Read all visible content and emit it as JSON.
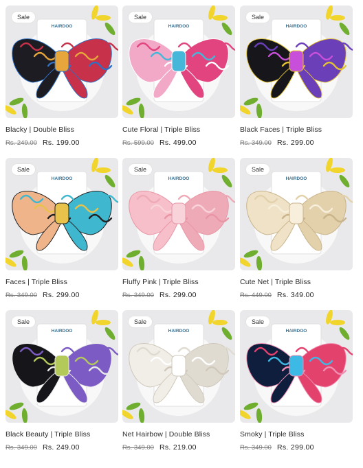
{
  "products": [
    {
      "badge": "Sale",
      "title": "Blacky | Double Bliss",
      "old_price": "Rs. 249.00",
      "price": "Rs. 199.00",
      "brand": "HAIRDOO",
      "colors": [
        "#1c1c22",
        "#c7314a",
        "#e6a63b",
        "#2f6fc4"
      ]
    },
    {
      "badge": "Sale",
      "title": "Cute Floral | Triple Bliss",
      "old_price": "Rs. 599.00",
      "price": "Rs. 499.00",
      "brand": "HAIRDOO",
      "colors": [
        "#f2a8c7",
        "#e2447f",
        "#46b6d9",
        "#ffffff"
      ]
    },
    {
      "badge": "Sale",
      "title": "Black Faces | Triple Bliss",
      "old_price": "Rs. 349.00",
      "price": "Rs. 299.00",
      "brand": "HAIRDOO",
      "colors": [
        "#17171b",
        "#6a3fb8",
        "#c84fd9",
        "#e2c233"
      ]
    },
    {
      "badge": "Sale",
      "title": "Faces | Triple Bliss",
      "old_price": "Rs. 349.00",
      "price": "Rs. 299.00",
      "brand": "HAIRDOO",
      "colors": [
        "#f0b48b",
        "#3eb7cf",
        "#e8c24a",
        "#222222"
      ]
    },
    {
      "badge": "Sale",
      "title": "Fluffy Pink | Triple Bliss",
      "old_price": "Rs. 349.00",
      "price": "Rs. 299.00",
      "brand": "HAIRDOO",
      "colors": [
        "#f6bfc9",
        "#efaab7",
        "#f9d3da",
        "#e896a6"
      ]
    },
    {
      "badge": "Sale",
      "title": "Cute Net | Triple Bliss",
      "old_price": "Rs. 449.00",
      "price": "Rs. 349.00",
      "brand": "HAIRDOO",
      "colors": [
        "#efe2c6",
        "#e2d1ab",
        "#f7eedc",
        "#c9b48c"
      ]
    },
    {
      "badge": "Sale",
      "title": "Black Beauty | Triple Bliss",
      "old_price": "Rs. 349.00",
      "price": "Rs. 249.00",
      "brand": "HAIRDOO",
      "colors": [
        "#16161a",
        "#7c5cc4",
        "#b3c95a",
        "#e9e9e9"
      ]
    },
    {
      "badge": "Sale",
      "title": "Net Hairbow | Double Bliss",
      "old_price": "Rs. 349.00",
      "price": "Rs. 219.00",
      "brand": "HAIRDOO",
      "colors": [
        "#f1eee8",
        "#e0dbd1",
        "#ffffff",
        "#cfc8bb"
      ]
    },
    {
      "badge": "Sale",
      "title": "Smoky | Triple Bliss",
      "old_price": "Rs. 349.00",
      "price": "Rs. 299.00",
      "brand": "HAIRDOO",
      "colors": [
        "#0f1e3d",
        "#e3426d",
        "#3db9e6",
        "#f08fb2"
      ]
    }
  ],
  "scene_colors": {
    "backdrop": "#e9e9eb",
    "plate": "#f8f8f8",
    "leaf": "#f1d52c",
    "leaf_dark": "#6fae2f"
  }
}
